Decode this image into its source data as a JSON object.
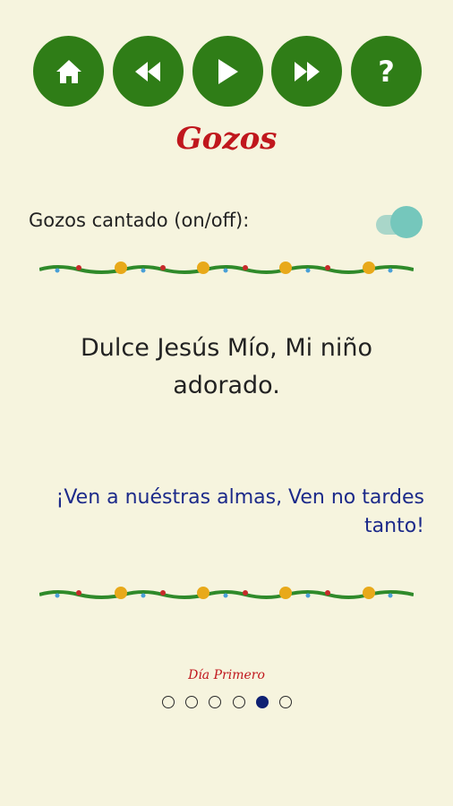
{
  "toolbar": {
    "buttons": [
      {
        "name": "home",
        "icon": "home-icon"
      },
      {
        "name": "previous",
        "icon": "rewind-icon"
      },
      {
        "name": "play",
        "icon": "play-icon"
      },
      {
        "name": "next",
        "icon": "fast-forward-icon"
      },
      {
        "name": "help",
        "icon": "question-icon",
        "label": "?"
      }
    ]
  },
  "title": "Gozos",
  "toggle": {
    "label": "Gozos cantado (on/off):",
    "state": "on"
  },
  "prayer": {
    "line": "Dulce Jesús Mío, Mi niño adorado.",
    "response": "¡Ven a nuéstras almas, Ven no tardes tanto!"
  },
  "day_label": "Día Primero",
  "pager": {
    "total": 6,
    "active_index": 4
  },
  "colors": {
    "background": "#f6f4de",
    "button": "#2f7d17",
    "title": "#c0171d",
    "response": "#1c2a8a",
    "toggle_on": "#75c7bc"
  }
}
